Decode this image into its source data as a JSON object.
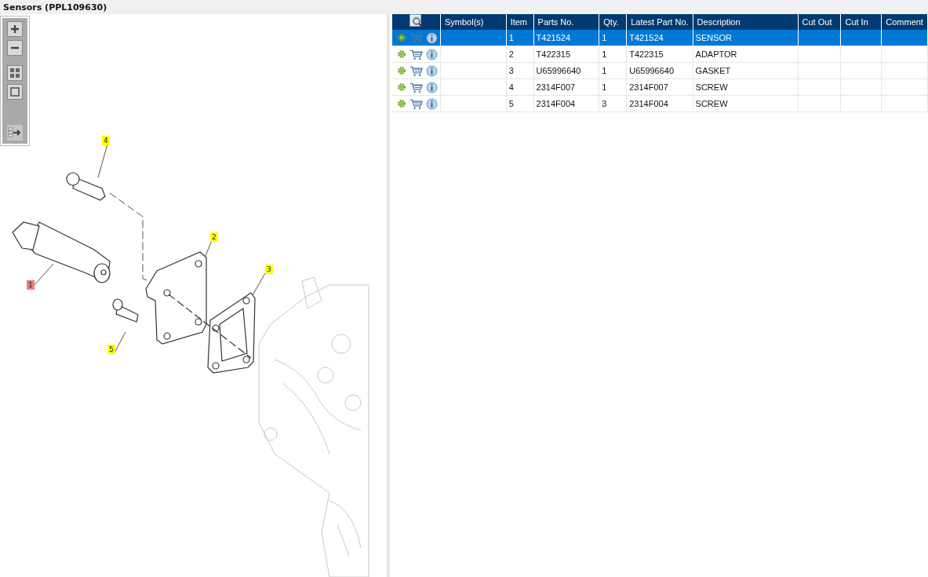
{
  "window": {
    "title": "Sensors (PPL109630)"
  },
  "callouts": [
    {
      "label": "4",
      "color": "#ffff00"
    },
    {
      "label": "2",
      "color": "#ffff00"
    },
    {
      "label": "3",
      "color": "#ffff00"
    },
    {
      "label": "1",
      "color": "#f47a7a"
    },
    {
      "label": "5",
      "color": "#ffff00"
    }
  ],
  "table": {
    "columns": [
      "Symbol(s)",
      "Item",
      "Parts No.",
      "Qty.",
      "Latest Part No.",
      "Description",
      "Cut Out",
      "Cut In",
      "Comment"
    ],
    "rows": [
      {
        "selected": true,
        "cells": [
          "",
          "1",
          "T421524",
          "1",
          "T421524",
          "SENSOR",
          "",
          "",
          ""
        ]
      },
      {
        "selected": false,
        "cells": [
          "",
          "2",
          "T422315",
          "1",
          "T422315",
          "ADAPTOR",
          "",
          "",
          ""
        ]
      },
      {
        "selected": false,
        "cells": [
          "",
          "3",
          "U65996640",
          "1",
          "U65996640",
          "GASKET",
          "",
          "",
          ""
        ]
      },
      {
        "selected": false,
        "cells": [
          "",
          "4",
          "2314F007",
          "1",
          "2314F007",
          "SCREW",
          "",
          "",
          ""
        ]
      },
      {
        "selected": false,
        "cells": [
          "",
          "5",
          "2314F004",
          "3",
          "2314F004",
          "SCREW",
          "",
          "",
          ""
        ]
      }
    ]
  }
}
